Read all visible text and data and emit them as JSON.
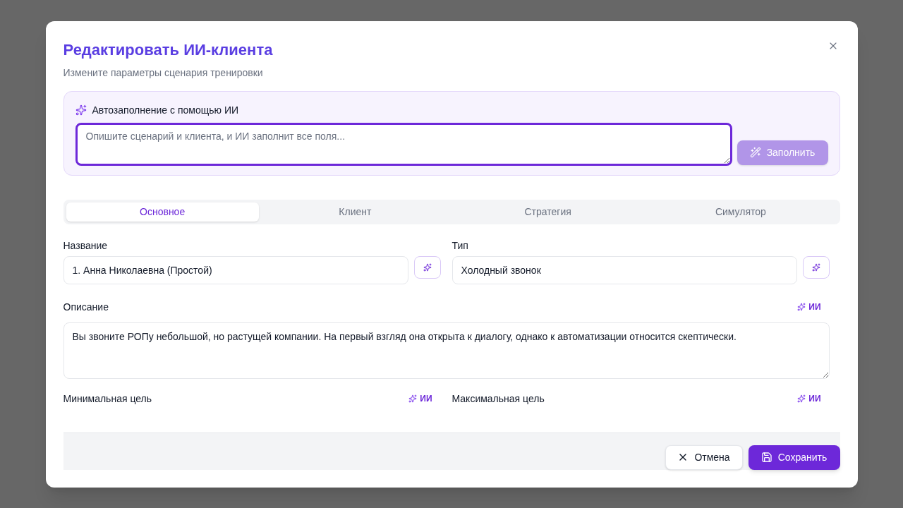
{
  "dialog": {
    "title": "Редактировать ИИ-клиента",
    "subtitle": "Измените параметры сценария тренировки"
  },
  "autofill": {
    "heading": "Автозаполнение с помощью ИИ",
    "placeholder": "Опишите сценарий и клиента, и ИИ заполнит все поля...",
    "focused": true,
    "button": {
      "label": "Заполнить",
      "disabled": true
    }
  },
  "tabs": [
    {
      "label": "Основное",
      "selected": true
    },
    {
      "label": "Клиент",
      "selected": false
    },
    {
      "label": "Стратегия",
      "selected": false
    },
    {
      "label": "Симулятор",
      "selected": false
    }
  ],
  "form": {
    "rows": [
      {
        "fields": [
          {
            "kind": "input",
            "label": "Название",
            "value": "1. Анна Николаевна (Простой)"
          },
          {
            "kind": "input",
            "label": "Тип",
            "value": "Холодный звонок"
          }
        ]
      },
      {
        "fields": [
          {
            "kind": "textarea",
            "label": "Описание",
            "ai_link": "ИИ",
            "value": "Вы звоните РОПу небольшой, но растущей компании. На первый взгляд она открыта к диалогу, однако к автоматизации относится скептически."
          }
        ]
      },
      {
        "fields": [
          {
            "kind": "label",
            "label": "Минимальная цель",
            "ai_link": "ИИ"
          },
          {
            "kind": "label",
            "label": "Максимальная цель",
            "ai_link": "ИИ"
          }
        ]
      }
    ]
  },
  "footer": {
    "buttons": [
      {
        "kind": "secondary",
        "label": "Отмена"
      },
      {
        "kind": "primary",
        "label": "Сохранить"
      }
    ]
  }
}
